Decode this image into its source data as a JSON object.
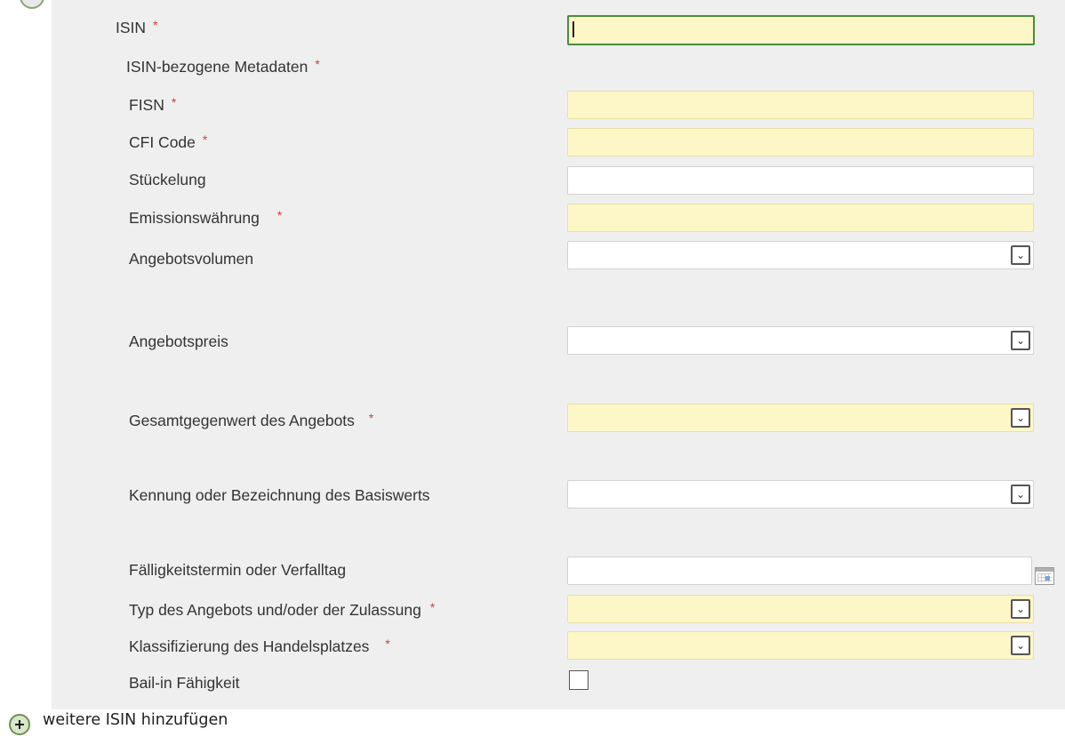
{
  "form": {
    "required_marker": "*",
    "isin": {
      "label": "ISIN",
      "value": ""
    },
    "metadata_heading": "ISIN-bezogene Metadaten",
    "fisn": {
      "label": "FISN",
      "value": ""
    },
    "cfi_code": {
      "label": "CFI Code",
      "value": ""
    },
    "stueckelung": {
      "label": "Stückelung",
      "value": ""
    },
    "emissionswaehrung": {
      "label": "Emissionswährung",
      "value": ""
    },
    "angebotsvolumen": {
      "label": "Angebotsvolumen",
      "value": ""
    },
    "angebotspreis": {
      "label": "Angebotspreis",
      "value": ""
    },
    "gesamtgegenwert": {
      "label": "Gesamtgegenwert des Angebots",
      "value": ""
    },
    "basiswert": {
      "label": "Kennung oder Bezeichnung des Basiswerts",
      "value": ""
    },
    "faelligkeit": {
      "label": "Fälligkeitstermin oder Verfalltag",
      "value": ""
    },
    "typ_angebot": {
      "label": "Typ des Angebots und/oder der Zulassung",
      "value": ""
    },
    "klassifizierung": {
      "label": "Klassifizierung des Handelsplatzes",
      "value": ""
    },
    "bail_in": {
      "label": "Bail-in Fähigkeit",
      "checked": false
    }
  },
  "dropdown_glyph": "⌄",
  "footer": {
    "add_isin_label": "weitere ISIN hinzufügen"
  },
  "colors": {
    "panel_bg": "#efefef",
    "required_field_bg": "#fdf7c7",
    "required_marker": "#d23c3c",
    "focus_border": "#4a8c3a"
  },
  "icons": [
    "calendar-icon",
    "add-circle-icon",
    "chevron-down-icon"
  ]
}
